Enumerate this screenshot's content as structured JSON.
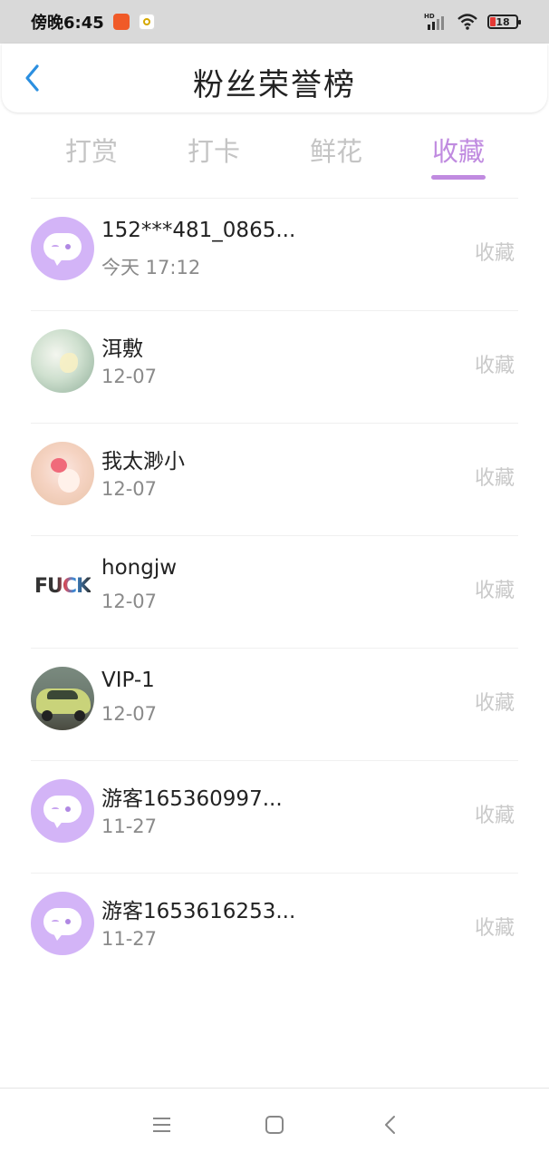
{
  "status_bar": {
    "time": "傍晚6:45",
    "network": "HD",
    "battery": "18"
  },
  "header": {
    "title": "粉丝荣誉榜",
    "back_icon": "chevron-left-icon"
  },
  "tabs": [
    {
      "label": "打赏",
      "active": false
    },
    {
      "label": "打卡",
      "active": false
    },
    {
      "label": "鲜花",
      "active": false
    },
    {
      "label": "收藏",
      "active": true
    }
  ],
  "colors": {
    "accent": "#c08be0",
    "default_avatar": "#d3b4f7",
    "muted_text": "#8a8a8a",
    "action_text": "#c9c9c9"
  },
  "list": [
    {
      "name": "152***481_0865...",
      "time": "今天 17:12",
      "action": "收藏",
      "avatar": "default"
    },
    {
      "name": "洱敷",
      "time": "12-07",
      "action": "收藏",
      "avatar": "green"
    },
    {
      "name": "我太渺小",
      "time": "12-07",
      "action": "收藏",
      "avatar": "pink"
    },
    {
      "name": "hongjw",
      "time": "12-07",
      "action": "收藏",
      "avatar": "fuck",
      "avatar_text": "FUCK"
    },
    {
      "name": "VIP-1",
      "time": "12-07",
      "action": "收藏",
      "avatar": "car"
    },
    {
      "name": "游客165360997...",
      "time": "11-27",
      "action": "收藏",
      "avatar": "default"
    },
    {
      "name": "游客1653616253...",
      "time": "11-27",
      "action": "收藏",
      "avatar": "default"
    }
  ],
  "nav_bar": {
    "menu_icon": "menu-icon",
    "home_icon": "home-square-icon",
    "back_icon": "back-triangle-icon"
  }
}
